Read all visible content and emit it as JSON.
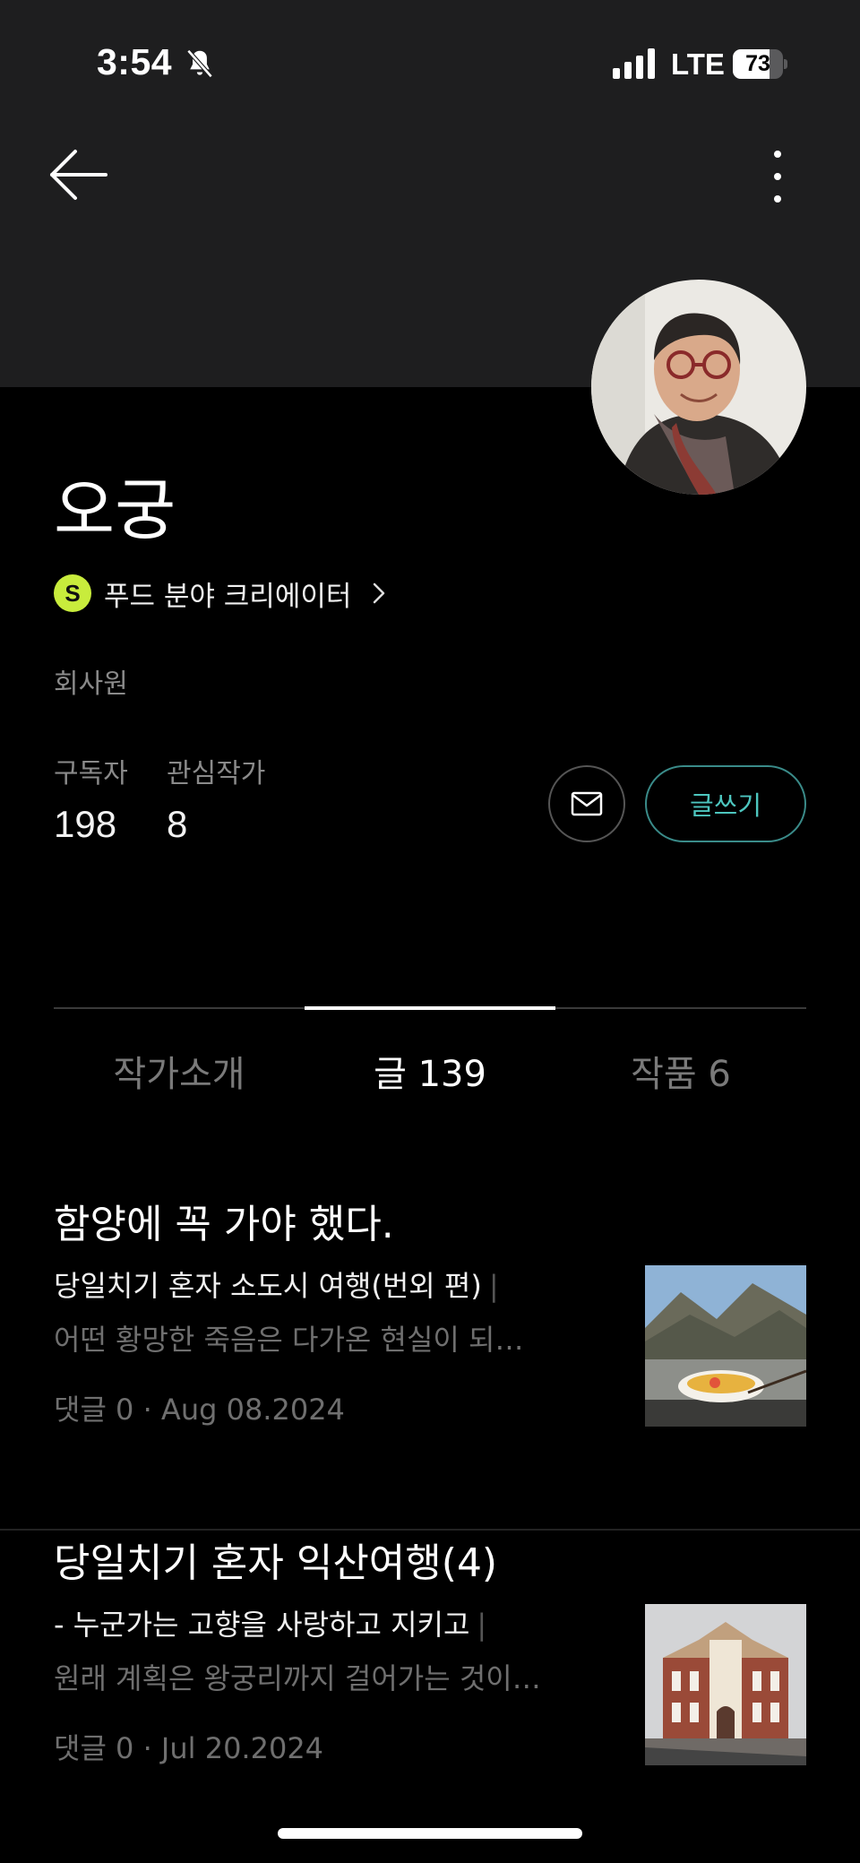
{
  "status_bar": {
    "time": "3:54",
    "network": "LTE",
    "battery_percent": "73",
    "battery_level": 0.73
  },
  "nav": {
    "back_icon": "arrow-left-icon",
    "more_icon": "more-vertical-icon"
  },
  "profile": {
    "name": "오궁",
    "badge_letter": "S",
    "badge_label": "푸드 분야 크리에이터",
    "badge_color": "#c8ec3c",
    "job": "회사원",
    "subscribers_label": "구독자",
    "subscribers_value": "198",
    "following_label": "관심작가",
    "following_value": "8",
    "write_button": "글쓰기",
    "accent_color": "#4dc6bf"
  },
  "tabs": [
    {
      "label": "작가소개",
      "active": false
    },
    {
      "label": "글 139",
      "active": true
    },
    {
      "label": "작품 6",
      "active": false
    }
  ],
  "posts": [
    {
      "title": "함양에 꼭 가야 했다.",
      "magazine": "당일치기 혼자 소도시 여행(번외 편)",
      "separator": "|",
      "excerpt": "어떤 황망한 죽음은 다가온 현실이 되…",
      "meta": "댓글 0 · Aug 08.2024"
    },
    {
      "title": "당일치기 혼자 익산여행(4)",
      "magazine": "- 누군가는 고향을 사랑하고 지키고",
      "separator": "|",
      "excerpt": "원래 계획은 왕궁리까지 걸어가는 것이…",
      "meta": "댓글 0 · Jul 20.2024"
    }
  ]
}
